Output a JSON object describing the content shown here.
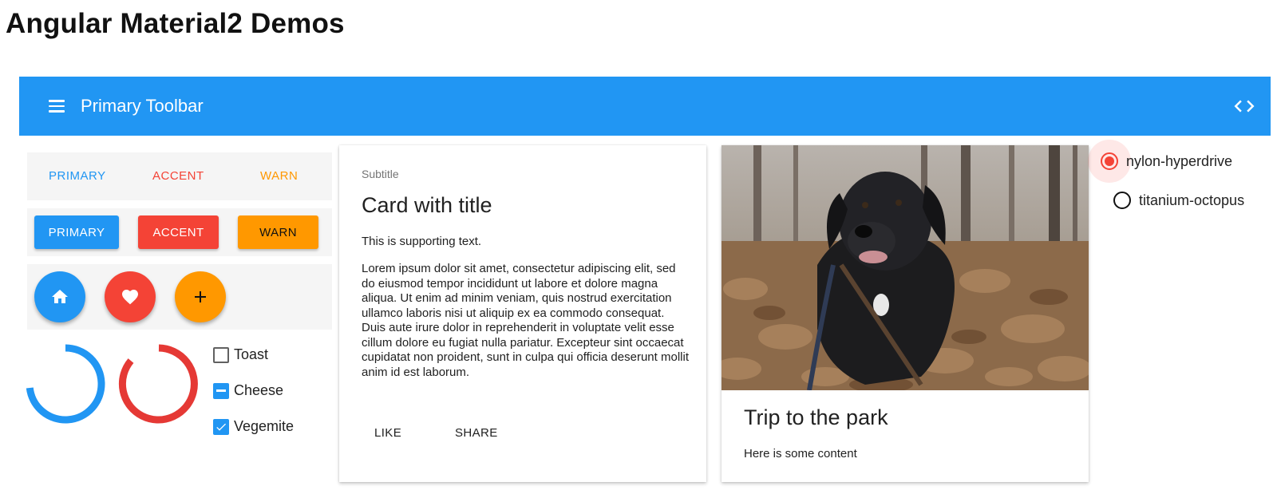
{
  "app": {
    "title": "Angular Material2 Demos"
  },
  "toolbar": {
    "title": "Primary Toolbar",
    "menu_icon": "menu-icon",
    "code_icon": "code-icon",
    "color": "#2196F3"
  },
  "colors": {
    "primary": "#2196F3",
    "accent": "#F44336",
    "warn": "#FF9800"
  },
  "flat_buttons": [
    {
      "label": "PRIMARY",
      "color": "#2196F3"
    },
    {
      "label": "ACCENT",
      "color": "#F44336"
    },
    {
      "label": "WARN",
      "color": "#FF9800"
    }
  ],
  "raised_buttons": [
    {
      "label": "PRIMARY",
      "bg": "#2196F3",
      "fg": "#ffffff"
    },
    {
      "label": "ACCENT",
      "bg": "#F44336",
      "fg": "#ffffff"
    },
    {
      "label": "WARN",
      "bg": "#FF9800",
      "fg": "#111111"
    }
  ],
  "fabs": [
    {
      "icon": "home-icon",
      "bg": "#2196F3"
    },
    {
      "icon": "heart-icon",
      "bg": "#F44336"
    },
    {
      "icon": "add-icon",
      "bg": "#FF9800"
    }
  ],
  "checkboxes": [
    {
      "label": "Toast",
      "state": "unchecked"
    },
    {
      "label": "Cheese",
      "state": "indeterminate"
    },
    {
      "label": "Vegemite",
      "state": "checked"
    }
  ],
  "card1": {
    "subtitle": "Subtitle",
    "title": "Card with title",
    "supporting_text": "This is supporting text.",
    "body": "Lorem ipsum dolor sit amet, consectetur adipiscing elit, sed do eiusmod tempor incididunt ut labore et dolore magna aliqua. Ut enim ad minim veniam, quis nostrud exercitation ullamco laboris nisi ut aliquip ex ea commodo consequat. Duis aute irure dolor in reprehenderit in voluptate velit esse cillum dolore eu fugiat nulla pariatur. Excepteur sint occaecat cupidatat non proident, sunt in culpa qui officia deserunt mollit anim id est laborum.",
    "actions": [
      "LIKE",
      "SHARE"
    ]
  },
  "card2": {
    "title": "Trip to the park",
    "content": "Here is some content"
  },
  "radios": [
    {
      "label": "nylon-hyperdrive",
      "selected": true
    },
    {
      "label": "titanium-octopus",
      "selected": false
    }
  ]
}
